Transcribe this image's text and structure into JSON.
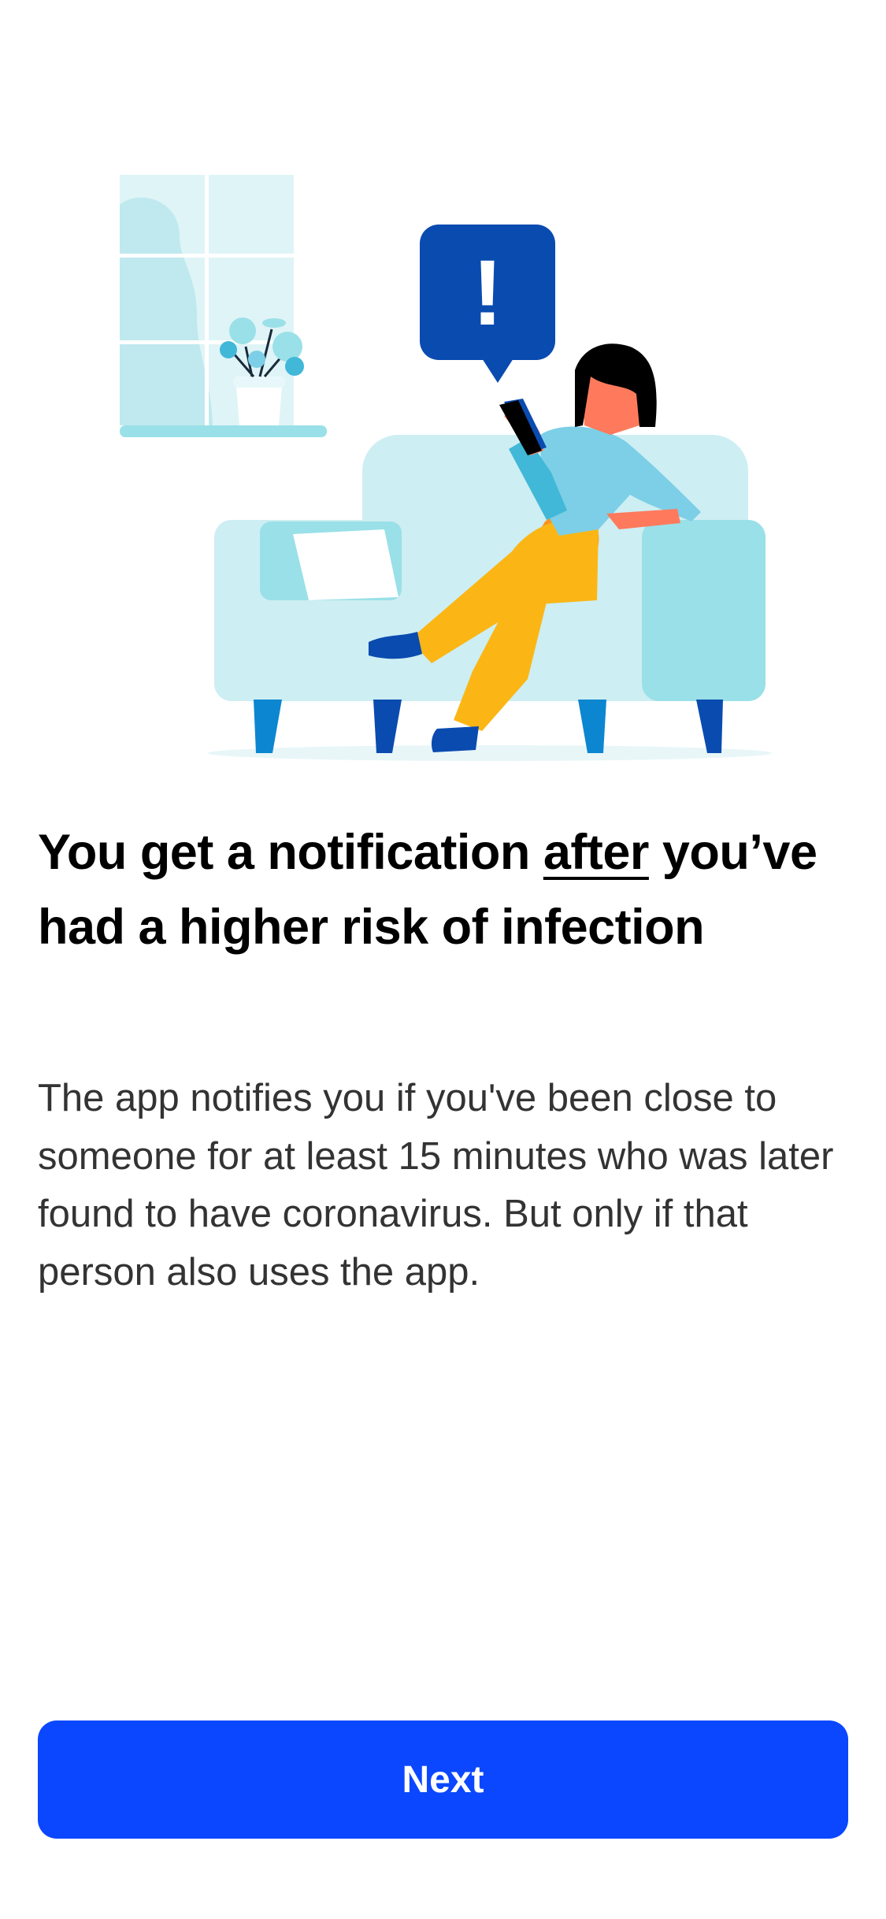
{
  "onboarding": {
    "title_before": "You get a notification ",
    "title_emphasis": "after",
    "title_after": " you’ve had a higher risk of infection",
    "body": "The app notifies you if you've been close to someone for at least 15 minutes who was later found to have coronavirus. But only if that person also uses the app.",
    "next_label": "Next"
  },
  "illustration": {
    "alert_symbol": "!"
  },
  "colors": {
    "primary_button": "#0a47ff",
    "alert_bubble": "#0a4bb0",
    "sofa": "#cdeef3",
    "sofa_accent": "#9ae0e8",
    "pants": "#fbb615",
    "shirt": "#7ccfe6",
    "skin": "#ff7a5c"
  }
}
